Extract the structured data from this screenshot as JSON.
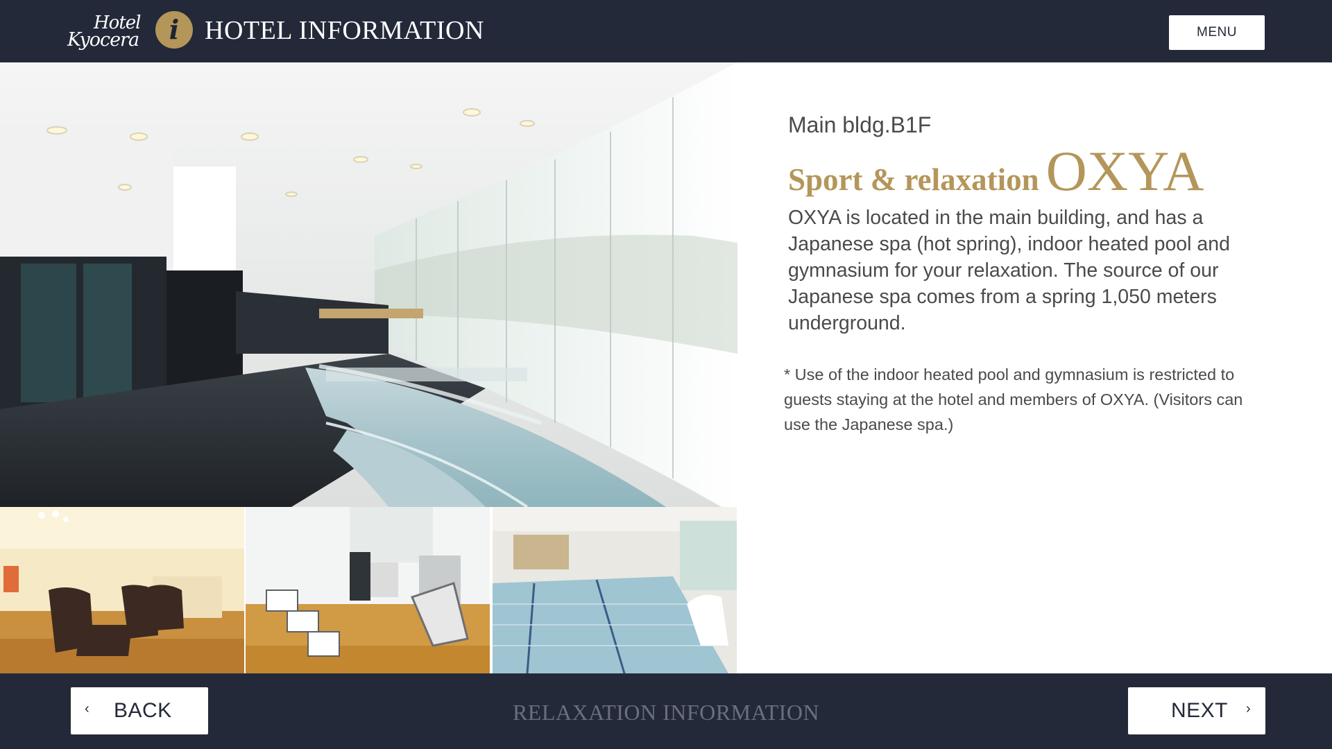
{
  "header": {
    "logo_line1": "Hotel",
    "logo_line2": "Kyocera",
    "info_icon": "i",
    "title": "HOTEL INFORMATION",
    "menu_label": "MENU"
  },
  "content": {
    "location": "Main bldg.B1F",
    "title_sub": "Sport & relaxation",
    "title_main": "OXYA",
    "description": "OXYA is located in the main building, and has a Japanese spa (hot spring), indoor heated pool and gymnasium for your relaxation. The source of our Japanese spa comes from a spring 1,050 meters underground.",
    "note": "* Use of the indoor heated pool and gymnasium is restricted to guests staying at the hotel and members of OXYA. (Visitors can use the Japanese spa.)"
  },
  "footer": {
    "back_label": "BACK",
    "back_icon": "chevron-left-icon",
    "section_title": "RELAXATION INFORMATION",
    "next_label": "NEXT",
    "next_icon": "chevron-right-icon"
  },
  "colors": {
    "navy": "#232939",
    "gold": "#b4965a",
    "white": "#ffffff",
    "text_gray": "#4a4a4a",
    "footer_title_gray": "#6a6f7c"
  }
}
